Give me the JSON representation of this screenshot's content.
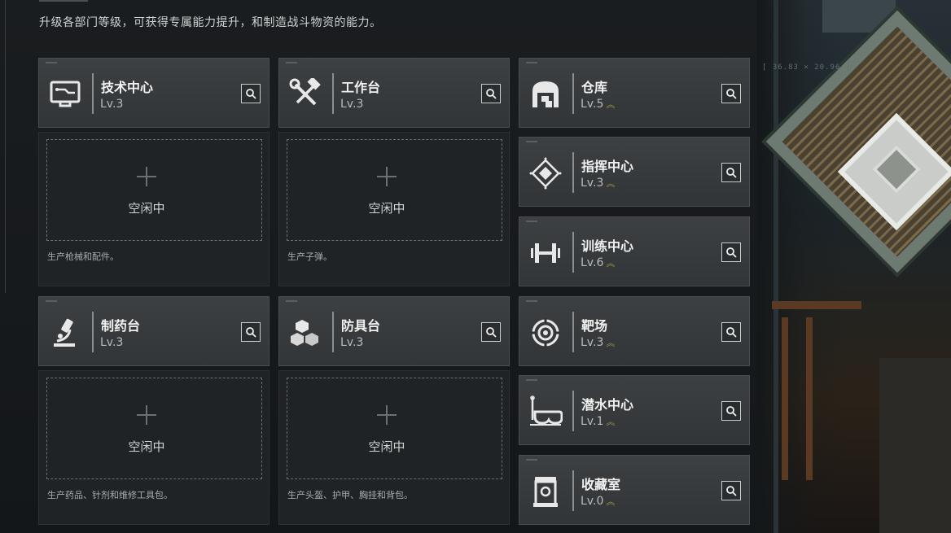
{
  "header": {
    "description": "升级各部门等级，可获得专属能力提升，和制造战斗物资的能力。"
  },
  "hud": {
    "readout": "[ 36.83 × 20.96 ]"
  },
  "production_cards": [
    {
      "name": "技术中心",
      "level": "Lv.3",
      "icon": "computer-icon"
    },
    {
      "name": "工作台",
      "level": "Lv.3",
      "icon": "hammer-wrench-icon"
    },
    {
      "name": "制药台",
      "level": "Lv.3",
      "icon": "microscope-icon"
    },
    {
      "name": "防具台",
      "level": "Lv.3",
      "icon": "cubes-icon"
    }
  ],
  "slots": [
    {
      "status": "空闲中",
      "description": "生产枪械和配件。"
    },
    {
      "status": "空闲中",
      "description": "生产子弹。"
    },
    {
      "status": "空闲中",
      "description": "生产药品、针剂和维修工具包。"
    },
    {
      "status": "空闲中",
      "description": "生产头盔、护甲、胸挂和背包。"
    }
  ],
  "facilities": [
    {
      "name": "仓库",
      "level": "Lv.5",
      "icon": "warehouse-icon"
    },
    {
      "name": "指挥中心",
      "level": "Lv.3",
      "icon": "command-diamond-icon"
    },
    {
      "name": "训练中心",
      "level": "Lv.6",
      "icon": "dumbbell-icon"
    },
    {
      "name": "靶场",
      "level": "Lv.3",
      "icon": "target-icon"
    },
    {
      "name": "潜水中心",
      "level": "Lv.1",
      "icon": "diving-mask-icon"
    },
    {
      "name": "收藏室",
      "level": "Lv.0",
      "icon": "display-case-icon"
    }
  ],
  "upgrade_indicator": "︽",
  "colors": {
    "accent": "#a49a44",
    "card": "#3a3d3f",
    "slot": "#202325"
  }
}
